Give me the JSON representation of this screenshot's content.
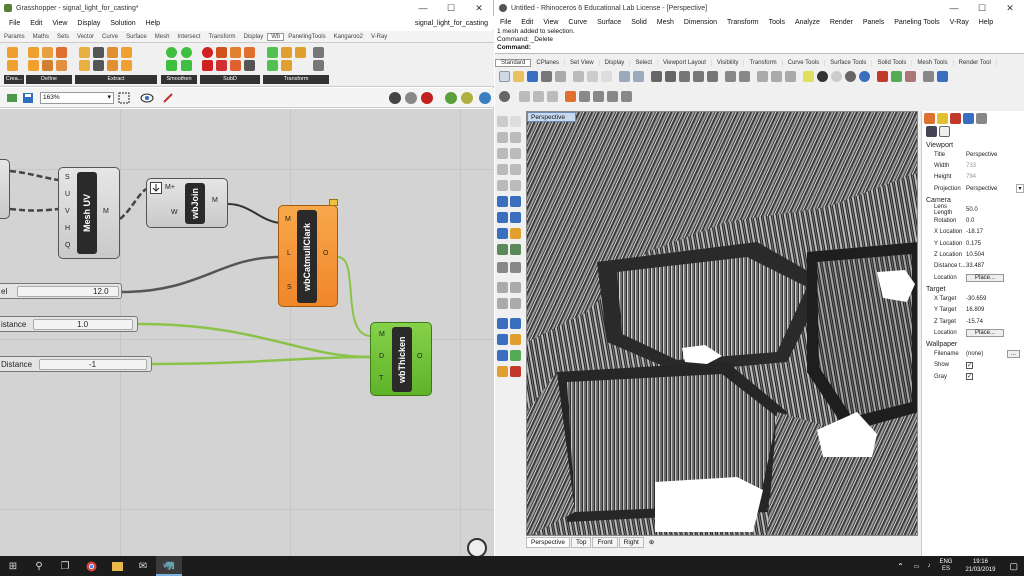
{
  "grasshopper": {
    "title": "Grasshopper - signal_light_for_casting*",
    "doc_name": "signal_light_for_casting",
    "menu": [
      "File",
      "Edit",
      "View",
      "Display",
      "Solution",
      "Help"
    ],
    "tabs": [
      "Params",
      "Maths",
      "Sets",
      "Vector",
      "Curve",
      "Surface",
      "Mesh",
      "Intersect",
      "Transform",
      "Display",
      "Wb",
      "PanelingTools",
      "Kangaroo2",
      "V-Ray"
    ],
    "active_tab": "Wb",
    "ribbon_groups": [
      "Crea...",
      "Define",
      "Extract",
      "Smoothen",
      "SubD",
      "Transform"
    ],
    "zoom": "163%",
    "components": {
      "mesh_uv": {
        "name": "Mesh UV",
        "inputs": [
          "S",
          "U",
          "V",
          "H",
          "Q"
        ],
        "outputs": [
          "M"
        ]
      },
      "wb_join": {
        "name": "wbJoin",
        "inputs": [
          "M+",
          "W"
        ],
        "outputs": [
          "M"
        ]
      },
      "catmull": {
        "name": "wbCatmullClark",
        "inputs": [
          "M",
          "L",
          "S"
        ],
        "outputs": [
          "O"
        ]
      },
      "thicken": {
        "name": "wbThicken",
        "inputs": [
          "M",
          "D",
          "T"
        ],
        "outputs": [
          "O"
        ]
      }
    },
    "sliders": [
      {
        "label": "el",
        "value": "12.0"
      },
      {
        "label": "istance",
        "value": "1.0"
      },
      {
        "label": "Distance",
        "value": "-1"
      }
    ]
  },
  "rhino": {
    "title": "Untitled - Rhinoceros 6 Educational Lab License - [Perspective]",
    "menu": [
      "File",
      "Edit",
      "View",
      "Curve",
      "Surface",
      "Solid",
      "Mesh",
      "Dimension",
      "Transform",
      "Tools",
      "Analyze",
      "Render",
      "Panels",
      "Paneling Tools",
      "V-Ray",
      "Help"
    ],
    "command_history": [
      "1 mesh added to selection.",
      "Command: _Delete"
    ],
    "command_prompt": "Command:",
    "toolbar_tabs": [
      "Standard",
      "CPlanes",
      "Set View",
      "Display",
      "Select",
      "Viewport Layout",
      "Visibility",
      "Transform",
      "Curve Tools",
      "Surface Tools",
      "Solid Tools",
      "Mesh Tools",
      "Render Tool"
    ],
    "viewport_label": "Perspective",
    "viewport_tabs": [
      "Perspective",
      "Top",
      "Front",
      "Right"
    ],
    "properties": {
      "viewport_header": "Viewport",
      "title_label": "Title",
      "title_value": "Perspective",
      "width_label": "Width",
      "width_value": "733",
      "height_label": "Height",
      "height_value": "794",
      "projection_label": "Projection",
      "projection_value": "Perspective",
      "camera_header": "Camera",
      "lens_label": "Lens Length",
      "lens_value": "50.0",
      "rotation_label": "Rotation",
      "rotation_value": "0.0",
      "xloc_label": "X Location",
      "xloc_value": "-18.17",
      "yloc_label": "Y Location",
      "yloc_value": "0.175",
      "zloc_label": "Z Location",
      "zloc_value": "10.504",
      "dist_label": "Distance t...",
      "dist_value": "33.487",
      "loc_label": "Location",
      "place_label": "Place...",
      "target_header": "Target",
      "xt_label": "X Target",
      "xt_value": "-30.659",
      "yt_label": "Y Target",
      "yt_value": "16.809",
      "zt_label": "Z Target",
      "zt_value": "-15.74",
      "wallpaper_header": "Wallpaper",
      "filename_label": "Filename",
      "filename_value": "(none)",
      "show_label": "Show",
      "gray_label": "Gray"
    }
  },
  "taskbar": {
    "lang": "ENG",
    "lang2": "ES",
    "time": "19:16",
    "date": "21/03/2019"
  },
  "colors": {
    "component_grey": "#d6d6d6",
    "component_orange": "#f3962f",
    "component_green": "#6cc233",
    "wire_green": "#8bc34a",
    "canvas": "#d3d3d3"
  }
}
